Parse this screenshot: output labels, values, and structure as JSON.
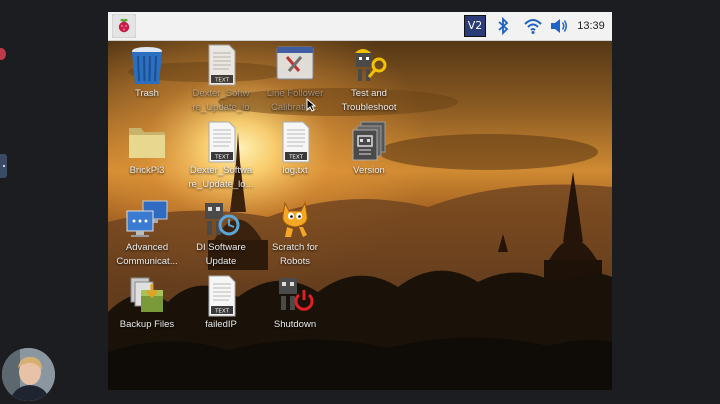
{
  "taskbar": {
    "menu_icon": "raspberry-pi-menu-icon",
    "tray": {
      "vnc_label": "V2",
      "bluetooth_icon": "bluetooth-icon",
      "wifi_icon": "wifi-icon",
      "volume_icon": "volume-icon",
      "clock": "13:39"
    }
  },
  "desktop": {
    "icons": [
      {
        "id": "trash",
        "label_lines": [
          "Trash"
        ],
        "icon": "trash-icon"
      },
      {
        "id": "dexter-software",
        "label_lines": [
          "Dexter_Softw",
          "re_Update_lo"
        ],
        "icon": "text-file-icon"
      },
      {
        "id": "line-follower",
        "label_lines": [
          "Line Follower",
          "Calibratio..."
        ],
        "icon": "line-follower-calibration-icon"
      },
      {
        "id": "test-troubleshoot",
        "label_lines": [
          "Test and",
          "Troubleshoot"
        ],
        "icon": "test-troubleshoot-icon"
      },
      {
        "id": "brickpi3",
        "label_lines": [
          "BrickPi3"
        ],
        "icon": "folder-icon"
      },
      {
        "id": "dexter-software-2",
        "label_lines": [
          "Dexter_Softwa",
          "re_Update_lo..."
        ],
        "icon": "text-file-icon"
      },
      {
        "id": "log",
        "label_lines": [
          "log.txt"
        ],
        "icon": "text-file-icon"
      },
      {
        "id": "version",
        "label_lines": [
          "Version"
        ],
        "icon": "version-icon"
      },
      {
        "id": "advanced-comm",
        "label_lines": [
          "Advanced",
          "Communicat..."
        ],
        "icon": "advanced-communications-icon"
      },
      {
        "id": "di-software-update",
        "label_lines": [
          "DI Software",
          "Update"
        ],
        "icon": "di-software-update-icon"
      },
      {
        "id": "scratch-robots",
        "label_lines": [
          "Scratch for",
          "Robots"
        ],
        "icon": "scratch-cat-icon"
      },
      {
        "id": "backup-files",
        "label_lines": [
          "Backup Files"
        ],
        "icon": "backup-files-icon"
      },
      {
        "id": "failed-ip",
        "label_lines": [
          "failedIP"
        ],
        "icon": "text-file-icon"
      },
      {
        "id": "shutdown",
        "label_lines": [
          "Shutdown"
        ],
        "icon": "shutdown-icon"
      }
    ],
    "text_file_badge": "TEXT"
  },
  "colors": {
    "taskbar_bg": "#f2f2f2",
    "sky_top": "#3e2810",
    "sun_glow": "#ffd777",
    "vnc_blue": "#2a3b78",
    "bluetooth_blue": "#1e63c7",
    "shutdown_red": "#e02020"
  }
}
